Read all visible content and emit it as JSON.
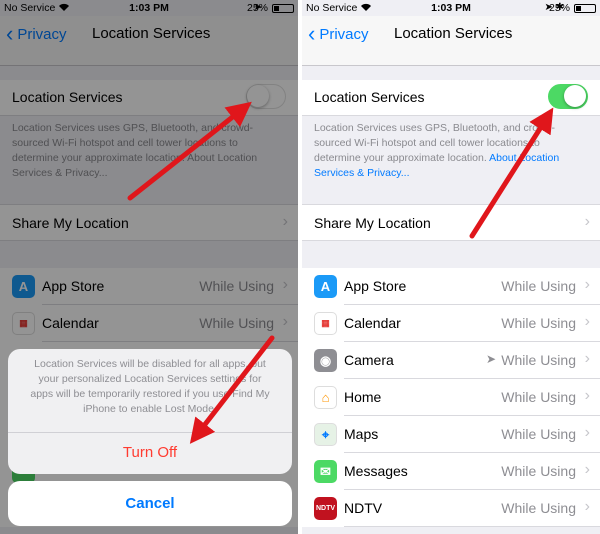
{
  "left": {
    "status": {
      "carrier": "No Service",
      "time": "1:03 PM",
      "battery": "25%"
    },
    "nav": {
      "back": "Privacy",
      "title": "Location Services"
    },
    "location_services": {
      "label": "Location Services",
      "on": false
    },
    "description": {
      "text": "Location Services uses GPS, Bluetooth, and crowd-sourced Wi-Fi hotspot and cell tower locations to determine your approximate location. About Location Services & Privacy..."
    },
    "share": {
      "label": "Share My Location"
    },
    "apps": [
      {
        "name": "App Store",
        "value": "While Using"
      },
      {
        "name": "Calendar",
        "value": "While Using"
      }
    ],
    "sheet": {
      "message": "Location Services will be disabled for all apps, but your personalized Location Services settings for apps will be temporarily restored if you use Find My iPhone to enable Lost Mode.",
      "turn_off": "Turn Off",
      "cancel": "Cancel"
    }
  },
  "right": {
    "status": {
      "carrier": "No Service",
      "time": "1:03 PM",
      "battery": "25%"
    },
    "nav": {
      "back": "Privacy",
      "title": "Location Services"
    },
    "location_services": {
      "label": "Location Services",
      "on": true
    },
    "description": {
      "text": "Location Services uses GPS, Bluetooth, and crowd-sourced Wi-Fi hotspot and cell tower locations to determine your approximate location. ",
      "link": "About Location Services & Privacy..."
    },
    "share": {
      "label": "Share My Location"
    },
    "apps": [
      {
        "name": "App Store",
        "value": "While Using",
        "icon": "app-store-icon",
        "color": "#1b9af7"
      },
      {
        "name": "Calendar",
        "value": "While Using",
        "icon": "calendar-icon",
        "color": "#ffffff"
      },
      {
        "name": "Camera",
        "value": "While Using",
        "icon": "camera-icon",
        "color": "#8e8e93",
        "recent": true
      },
      {
        "name": "Home",
        "value": "While Using",
        "icon": "home-icon",
        "color": "#ffffff"
      },
      {
        "name": "Maps",
        "value": "While Using",
        "icon": "maps-icon",
        "color": "#e6f2e6"
      },
      {
        "name": "Messages",
        "value": "While Using",
        "icon": "messages-icon",
        "color": "#4cd964"
      },
      {
        "name": "NDTV",
        "value": "While Using",
        "icon": "ndtv-icon",
        "color": "#c1121f"
      }
    ]
  },
  "colors": {
    "accent": "#007aff",
    "switch_on": "#4cd964",
    "destructive": "#ff3b30",
    "annotation_arrow": "#e0161b"
  }
}
